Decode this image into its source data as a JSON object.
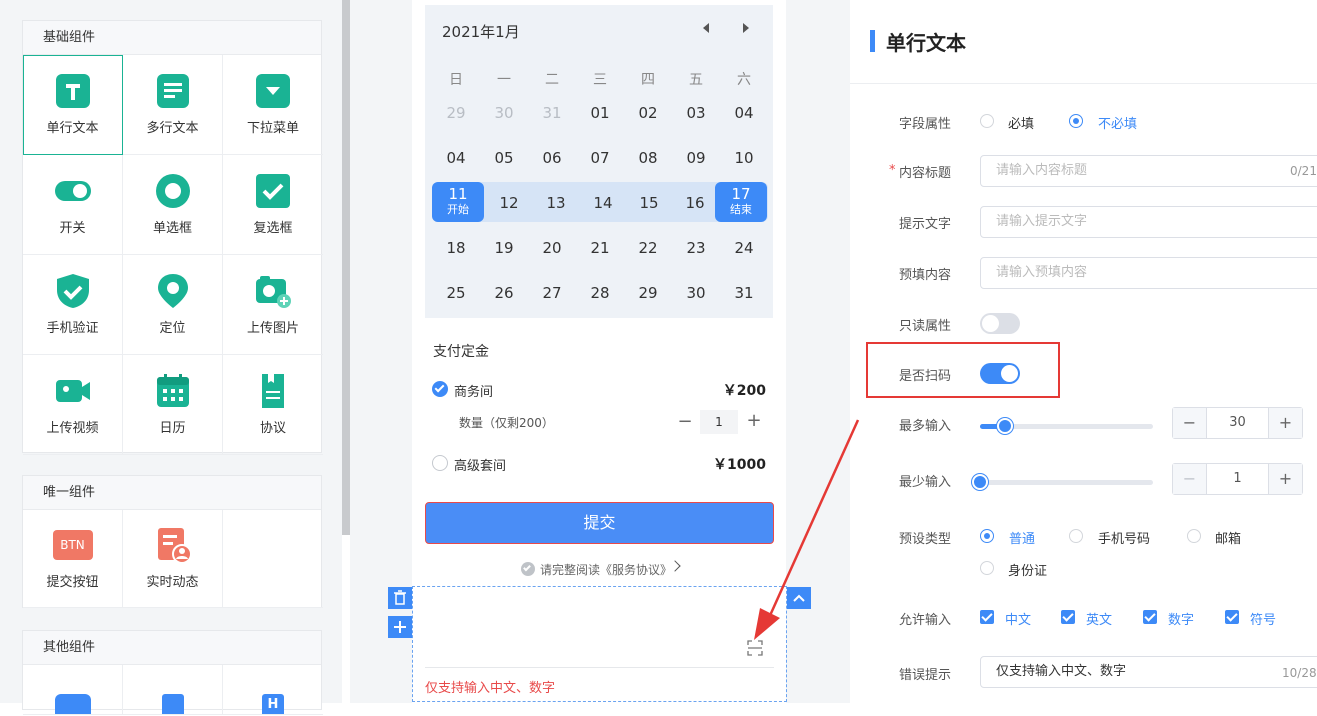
{
  "left": {
    "basic": {
      "title": "基础组件",
      "items": [
        {
          "label": "单行文本",
          "icon": "text-icon"
        },
        {
          "label": "多行文本",
          "icon": "multiline-icon"
        },
        {
          "label": "下拉菜单",
          "icon": "dropdown-icon"
        },
        {
          "label": "开关",
          "icon": "toggle-icon"
        },
        {
          "label": "单选框",
          "icon": "radio-icon"
        },
        {
          "label": "复选框",
          "icon": "checkbox-icon"
        },
        {
          "label": "手机验证",
          "icon": "shield-icon"
        },
        {
          "label": "定位",
          "icon": "location-icon"
        },
        {
          "label": "上传图片",
          "icon": "camera-icon"
        },
        {
          "label": "上传视频",
          "icon": "video-icon"
        },
        {
          "label": "日历",
          "icon": "calendar-icon"
        },
        {
          "label": "协议",
          "icon": "document-icon"
        }
      ]
    },
    "unique": {
      "title": "唯一组件",
      "items": [
        {
          "label": "提交按钮",
          "icon": "btn-icon",
          "badge": "BTN"
        },
        {
          "label": "实时动态",
          "icon": "activity-icon"
        }
      ]
    },
    "other": {
      "title": "其他组件"
    }
  },
  "calendar": {
    "month": "2021年1月",
    "weekdays": [
      "日",
      "一",
      "二",
      "三",
      "四",
      "五",
      "六"
    ],
    "rows": [
      [
        "29",
        "30",
        "31",
        "01",
        "02",
        "03",
        "04"
      ],
      [
        "04",
        "05",
        "06",
        "07",
        "08",
        "09",
        "10"
      ],
      [
        "11",
        "12",
        "13",
        "14",
        "15",
        "16",
        "17"
      ],
      [
        "18",
        "19",
        "20",
        "21",
        "22",
        "23",
        "24"
      ],
      [
        "25",
        "26",
        "27",
        "28",
        "29",
        "30",
        "31"
      ]
    ],
    "start_label": "开始",
    "end_label": "结束"
  },
  "deposit": {
    "title": "支付定金",
    "option1": "商务间",
    "price1": "￥200",
    "qty_label": "数量（仅剩200）",
    "qty_minus": "−",
    "qty_value": "1",
    "qty_plus": "+",
    "option2": "高级套间",
    "price2": "￥1000"
  },
  "submit": {
    "label": "提交",
    "agreement": "请完整阅读《服务协议》"
  },
  "field_preview": {
    "error_text": "仅支持输入中文、数字"
  },
  "right": {
    "title": "单行文本",
    "field_attr": {
      "label": "字段属性",
      "opt1": "必填",
      "opt2": "不必填"
    },
    "content_title": {
      "label": "内容标题",
      "placeholder": "请输入内容标题",
      "count": "0/21"
    },
    "hint_text": {
      "label": "提示文字",
      "placeholder": "请输入提示文字"
    },
    "prefill": {
      "label": "预填内容",
      "placeholder": "请输入预填内容"
    },
    "readonly": {
      "label": "只读属性"
    },
    "scan": {
      "label": "是否扫码"
    },
    "max_input": {
      "label": "最多输入",
      "value": "30",
      "minus": "−",
      "plus": "+"
    },
    "min_input": {
      "label": "最少输入",
      "value": "1",
      "minus": "−",
      "plus": "+"
    },
    "preset": {
      "label": "预设类型",
      "opt1": "普通",
      "opt2": "手机号码",
      "opt3": "邮箱",
      "opt4": "身份证"
    },
    "allow": {
      "label": "允许输入",
      "opt1": "中文",
      "opt2": "英文",
      "opt3": "数字",
      "opt4": "符号"
    },
    "error": {
      "label": "错误提示",
      "value": "仅支持输入中文、数字",
      "count": "10/28"
    }
  },
  "colors": {
    "accent": "#3d8af7",
    "green": "#1ab394",
    "red": "#e84a4a",
    "highlight": "#e53935"
  }
}
